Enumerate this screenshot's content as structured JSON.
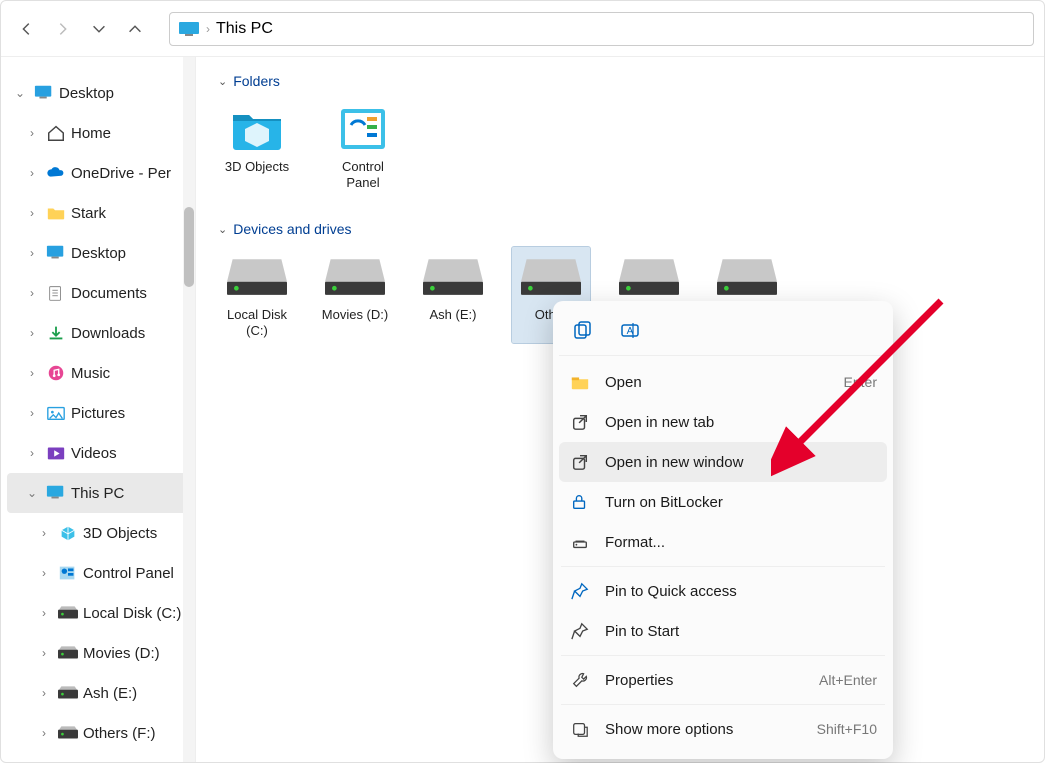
{
  "toolbar": {
    "breadcrumb": "This PC"
  },
  "sidebar": {
    "items": [
      {
        "label": "Desktop",
        "expand": "down",
        "lvl": 0,
        "icon": "desktop-blue"
      },
      {
        "label": "Home",
        "expand": "right",
        "lvl": 1,
        "icon": "home"
      },
      {
        "label": "OneDrive - Per",
        "expand": "right",
        "lvl": 1,
        "icon": "onedrive"
      },
      {
        "label": "Stark",
        "expand": "right",
        "lvl": 1,
        "icon": "folder"
      },
      {
        "label": "Desktop",
        "expand": "right",
        "lvl": 1,
        "icon": "desktop"
      },
      {
        "label": "Documents",
        "expand": "right",
        "lvl": 1,
        "icon": "documents"
      },
      {
        "label": "Downloads",
        "expand": "right",
        "lvl": 1,
        "icon": "downloads"
      },
      {
        "label": "Music",
        "expand": "right",
        "lvl": 1,
        "icon": "music"
      },
      {
        "label": "Pictures",
        "expand": "right",
        "lvl": 1,
        "icon": "pictures"
      },
      {
        "label": "Videos",
        "expand": "right",
        "lvl": 1,
        "icon": "videos"
      },
      {
        "label": "This PC",
        "expand": "down",
        "lvl": 1,
        "icon": "pc",
        "selected": true
      },
      {
        "label": "3D Objects",
        "expand": "right",
        "lvl": 2,
        "icon": "3d"
      },
      {
        "label": "Control Panel",
        "expand": "right",
        "lvl": 2,
        "icon": "cpanel"
      },
      {
        "label": "Local Disk (C:)",
        "expand": "right",
        "lvl": 2,
        "icon": "drive"
      },
      {
        "label": "Movies (D:)",
        "expand": "right",
        "lvl": 2,
        "icon": "drive"
      },
      {
        "label": "Ash (E:)",
        "expand": "right",
        "lvl": 2,
        "icon": "drive"
      },
      {
        "label": "Others (F:)",
        "expand": "right",
        "lvl": 2,
        "icon": "drive"
      }
    ]
  },
  "main": {
    "sections": {
      "folders_label": "Folders",
      "drives_label": "Devices and drives"
    },
    "folders": [
      {
        "label": "3D Objects",
        "icon": "3dfolder"
      },
      {
        "label": "Control Panel",
        "icon": "cpanel-large"
      }
    ],
    "drives": [
      {
        "label": "Local Disk (C:)"
      },
      {
        "label": "Movies (D:)"
      },
      {
        "label": "Ash (E:)"
      },
      {
        "label": "Other",
        "selected": true
      },
      {
        "label": ""
      },
      {
        "label": ""
      }
    ]
  },
  "ctx": {
    "open": "Open",
    "open_acc": "Enter",
    "new_tab": "Open in new tab",
    "new_window": "Open in new window",
    "bitlocker": "Turn on BitLocker",
    "format": "Format...",
    "pin_quick": "Pin to Quick access",
    "pin_start": "Pin to Start",
    "properties": "Properties",
    "properties_acc": "Alt+Enter",
    "more": "Show more options",
    "more_acc": "Shift+F10"
  }
}
